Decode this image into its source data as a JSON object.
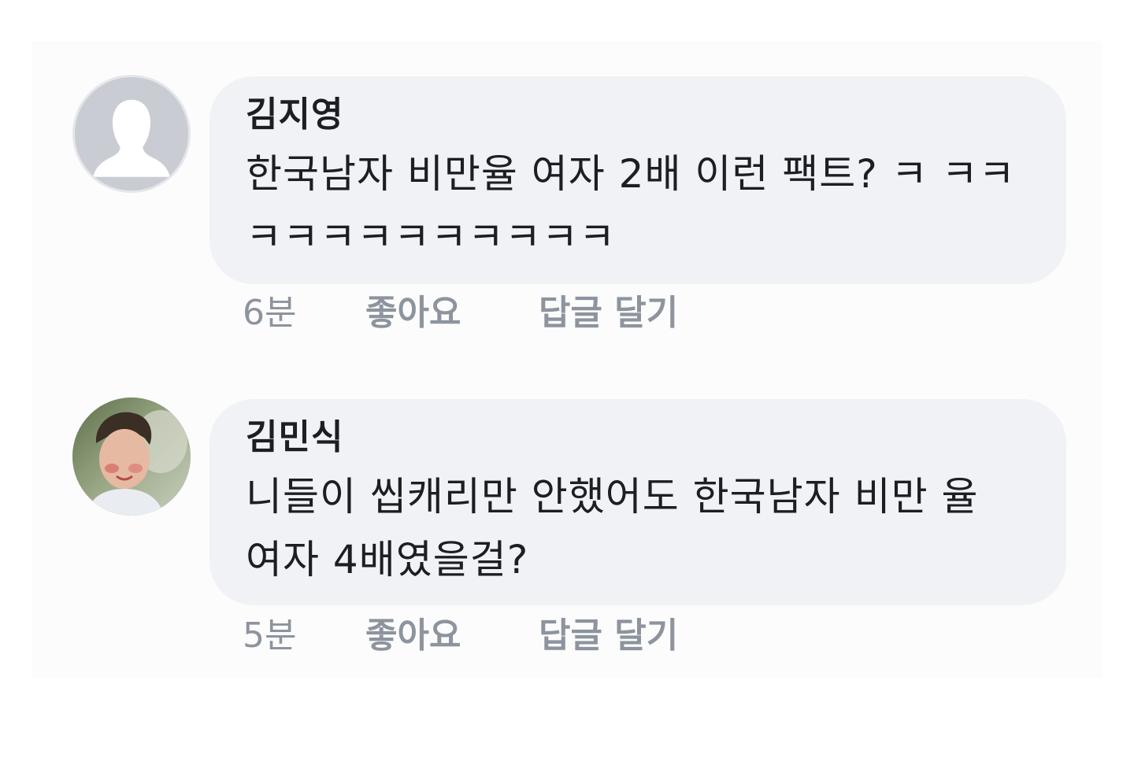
{
  "comments": [
    {
      "author": "김지영",
      "text": "한국남자 비만율 여자 2배 이런 팩트? ㅋ ㅋㅋㅋㅋㅋㅋㅋㅋㅋㅋㅋㅋ",
      "time": "6분",
      "like_label": "좋아요",
      "reply_label": "답글 달기",
      "avatar_icon": "default-profile-icon"
    },
    {
      "author": "김민식",
      "text": "니들이 씹캐리만 안했어도 한국남자 비만 율 여자 4배였을걸?",
      "time": "5분",
      "like_label": "좋아요",
      "reply_label": "답글 달기",
      "avatar_icon": "profile-photo"
    }
  ],
  "colors": {
    "bubble": "#f0f2f5",
    "text": "#1c1e21",
    "meta": "#8d949e"
  }
}
